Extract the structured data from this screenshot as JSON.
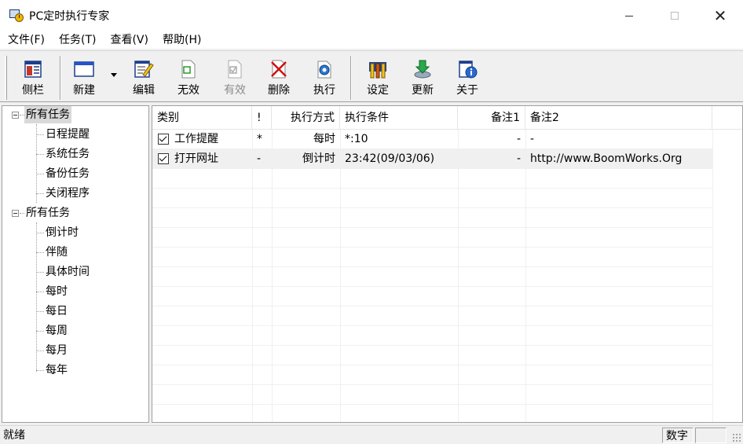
{
  "window": {
    "title": "PC定时执行专家",
    "icons": {
      "app": "clock-screen-icon",
      "minimize": "minimize-icon",
      "maximize": "maximize-icon",
      "close": "close-icon"
    },
    "close_glyph": "✕"
  },
  "menu": [
    {
      "label": "文件(F)",
      "name": "menu-file"
    },
    {
      "label": "任务(T)",
      "name": "menu-task"
    },
    {
      "label": "查看(V)",
      "name": "menu-view"
    },
    {
      "label": "帮助(H)",
      "name": "menu-help"
    }
  ],
  "toolbar": {
    "sidebar": "侧栏",
    "new": "新建",
    "edit": "编辑",
    "disable": "无效",
    "enable": "有效",
    "delete": "删除",
    "execute": "执行",
    "settings": "设定",
    "update": "更新",
    "about": "关于"
  },
  "tree": {
    "group1": {
      "label": "所有任务",
      "children": [
        "日程提醒",
        "系统任务",
        "备份任务",
        "关闭程序"
      ]
    },
    "group2": {
      "label": "所有任务",
      "children": [
        "倒计时",
        "伴随",
        "具体时间",
        "每时",
        "每日",
        "每周",
        "每月",
        "每年"
      ]
    }
  },
  "list": {
    "columns": [
      "类别",
      "!",
      "执行方式",
      "执行条件",
      "备注1",
      "备注2"
    ],
    "rows": [
      {
        "checked": true,
        "category": "工作提醒",
        "priority": "*",
        "mode": "每时",
        "condition": "*:10",
        "note1": "-",
        "note2": "-"
      },
      {
        "checked": true,
        "category": "打开网址",
        "priority": "-",
        "mode": "倒计时",
        "condition": "23:42(09/03/06)",
        "note1": "-",
        "note2": "http://www.BoomWorks.Org"
      }
    ]
  },
  "status": {
    "text": "就绪",
    "numlock": "数字"
  },
  "colors": {
    "selection": "#d9d9d9",
    "row_highlight": "#f0f0f0",
    "chrome": "#f0f0f0"
  }
}
